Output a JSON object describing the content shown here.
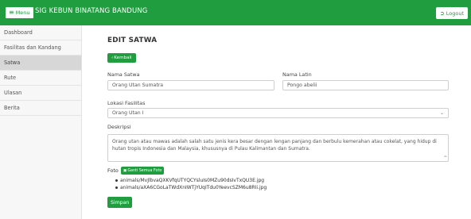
{
  "navbar": {
    "menu_icon": "hamburger-icon",
    "menu_label": "Menu",
    "brand": "SIG KEBUN BINATANG BANDUNG",
    "logout_icon": "logout-icon",
    "logout_label": "Logout"
  },
  "sidebar": {
    "items": [
      {
        "label": "Dashboard"
      },
      {
        "label": "Fasilitas dan Kandang"
      },
      {
        "label": "Satwa"
      },
      {
        "label": "Rute"
      },
      {
        "label": "Ulasan"
      },
      {
        "label": "Berita"
      }
    ],
    "active": "Satwa"
  },
  "form": {
    "title": "EDIT SATWA",
    "back_label": "Kembali",
    "nama_satwa_label": "Nama Satwa",
    "nama_satwa_value": "Orang Utan Sumatra",
    "nama_latin_label": "Nama Latin",
    "nama_latin_value": "Pongo abelii",
    "lokasi_label": "Lokasi Fasilitas",
    "lokasi_value": "Orang Utan I",
    "deskripsi_label": "Deskripsi",
    "deskripsi_value": "Orang utan atau mawas adalah salah satu jenis kera besar dengan lengan panjang dan berbulu kemerahan atau cokelat, yang hidup di hutan tropis Indonesia dan Malaysia, khususnya di Pulau Kalimantan dan Sumatra.",
    "foto_label": "Foto",
    "replace_label": "Ganti Semua Foto",
    "files": [
      "animals/MvJlbvaQXKVfqUTYQCYsluIs0MZu90dsIvTxQU3E.jpg",
      "animals/aXA6CGoLaTWdXnIWTjYUqITdu0YeevcSZM6u8RIi.jpg"
    ],
    "save_label": "Simpan"
  },
  "colors": {
    "brand_green": "#1f9d3f",
    "sidebar_bg": "#f7f7f7",
    "active_item": "#d7d7d7"
  }
}
